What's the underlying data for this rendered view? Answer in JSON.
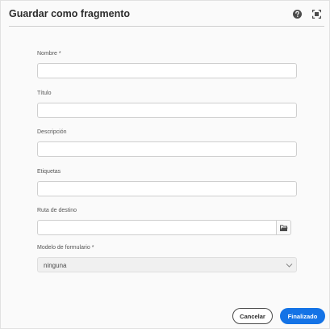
{
  "dialog": {
    "title": "Guardar como fragmento",
    "icons": {
      "help": "help-icon",
      "fullscreen": "fullscreen-icon"
    }
  },
  "form": {
    "name_label": "Nombre *",
    "name_value": "",
    "title_label": "Título",
    "title_value": "",
    "description_label": "Descripción",
    "description_value": "",
    "tags_label": "Etiquetas",
    "tags_value": "",
    "path_label": "Ruta de destino",
    "path_value": "",
    "model_label": "Modelo de formulario *",
    "model_value": "ninguna"
  },
  "footer": {
    "cancel_label": "Cancelar",
    "done_label": "Finalizado"
  },
  "colors": {
    "accent": "#1473e6",
    "background": "#fafafa"
  }
}
